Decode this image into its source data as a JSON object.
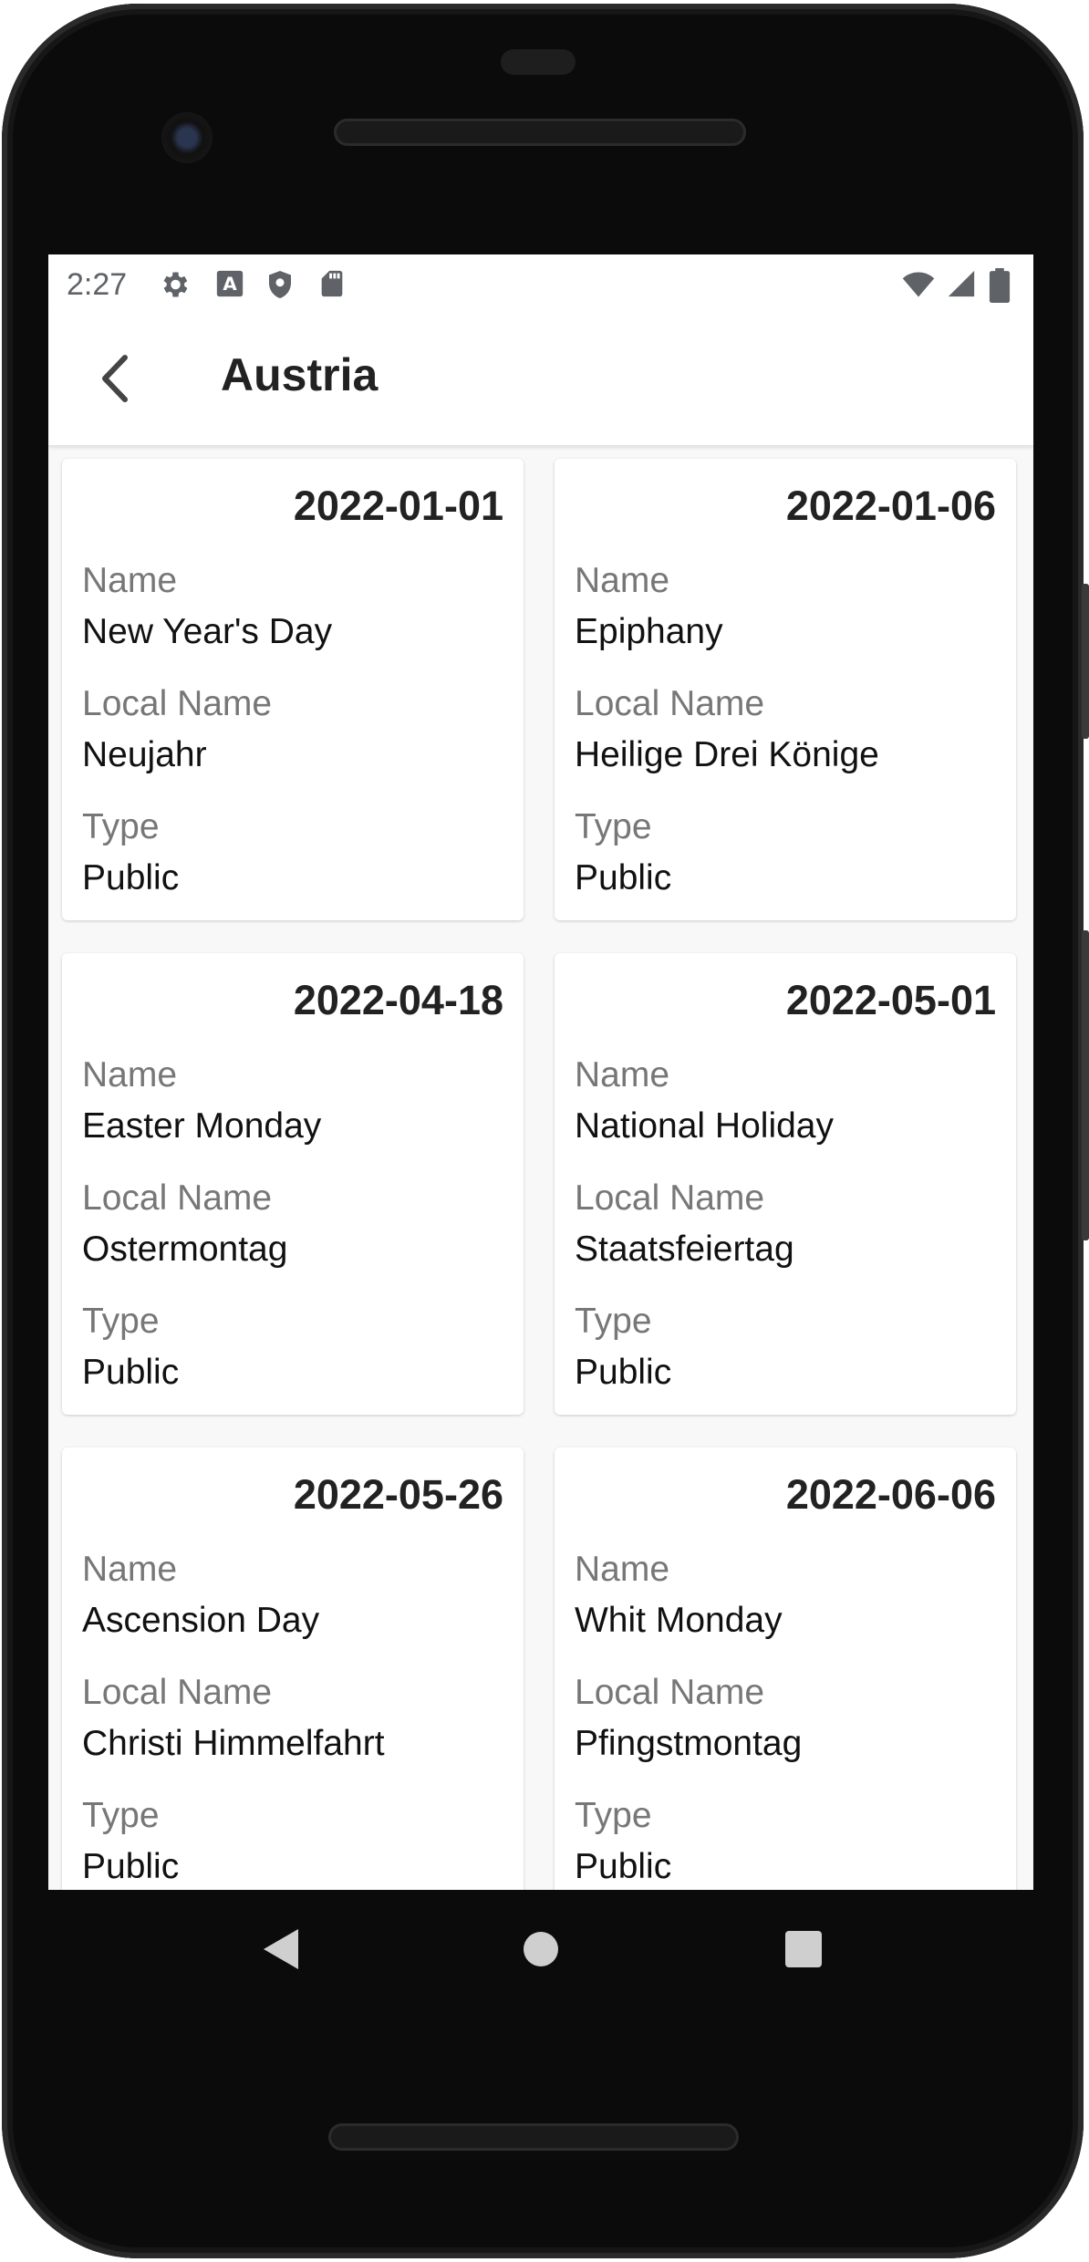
{
  "status_bar": {
    "time": "2:27",
    "left_icons": [
      "settings-icon",
      "a-letter-icon",
      "shield-icon",
      "sd-card-icon"
    ],
    "right_icons": [
      "wifi-icon",
      "signal-icon",
      "battery-icon"
    ]
  },
  "app_bar": {
    "title": "Austria",
    "back_icon": "chevron-left-icon"
  },
  "labels": {
    "name": "Name",
    "local_name": "Local Name",
    "type": "Type"
  },
  "holidays": [
    {
      "date": "2022-01-01",
      "name": "New Year's Day",
      "local_name": "Neujahr",
      "type": "Public"
    },
    {
      "date": "2022-01-06",
      "name": "Epiphany",
      "local_name": "Heilige Drei Könige",
      "type": "Public"
    },
    {
      "date": "2022-04-18",
      "name": "Easter Monday",
      "local_name": "Ostermontag",
      "type": "Public"
    },
    {
      "date": "2022-05-01",
      "name": "National Holiday",
      "local_name": "Staatsfeiertag",
      "type": "Public"
    },
    {
      "date": "2022-05-26",
      "name": "Ascension Day",
      "local_name": "Christi Himmelfahrt",
      "type": "Public"
    },
    {
      "date": "2022-06-06",
      "name": "Whit Monday",
      "local_name": "Pfingstmontag",
      "type": "Public"
    }
  ],
  "nav_bar": {
    "icons": [
      "back-triangle-icon",
      "home-circle-icon",
      "recents-square-icon"
    ]
  }
}
